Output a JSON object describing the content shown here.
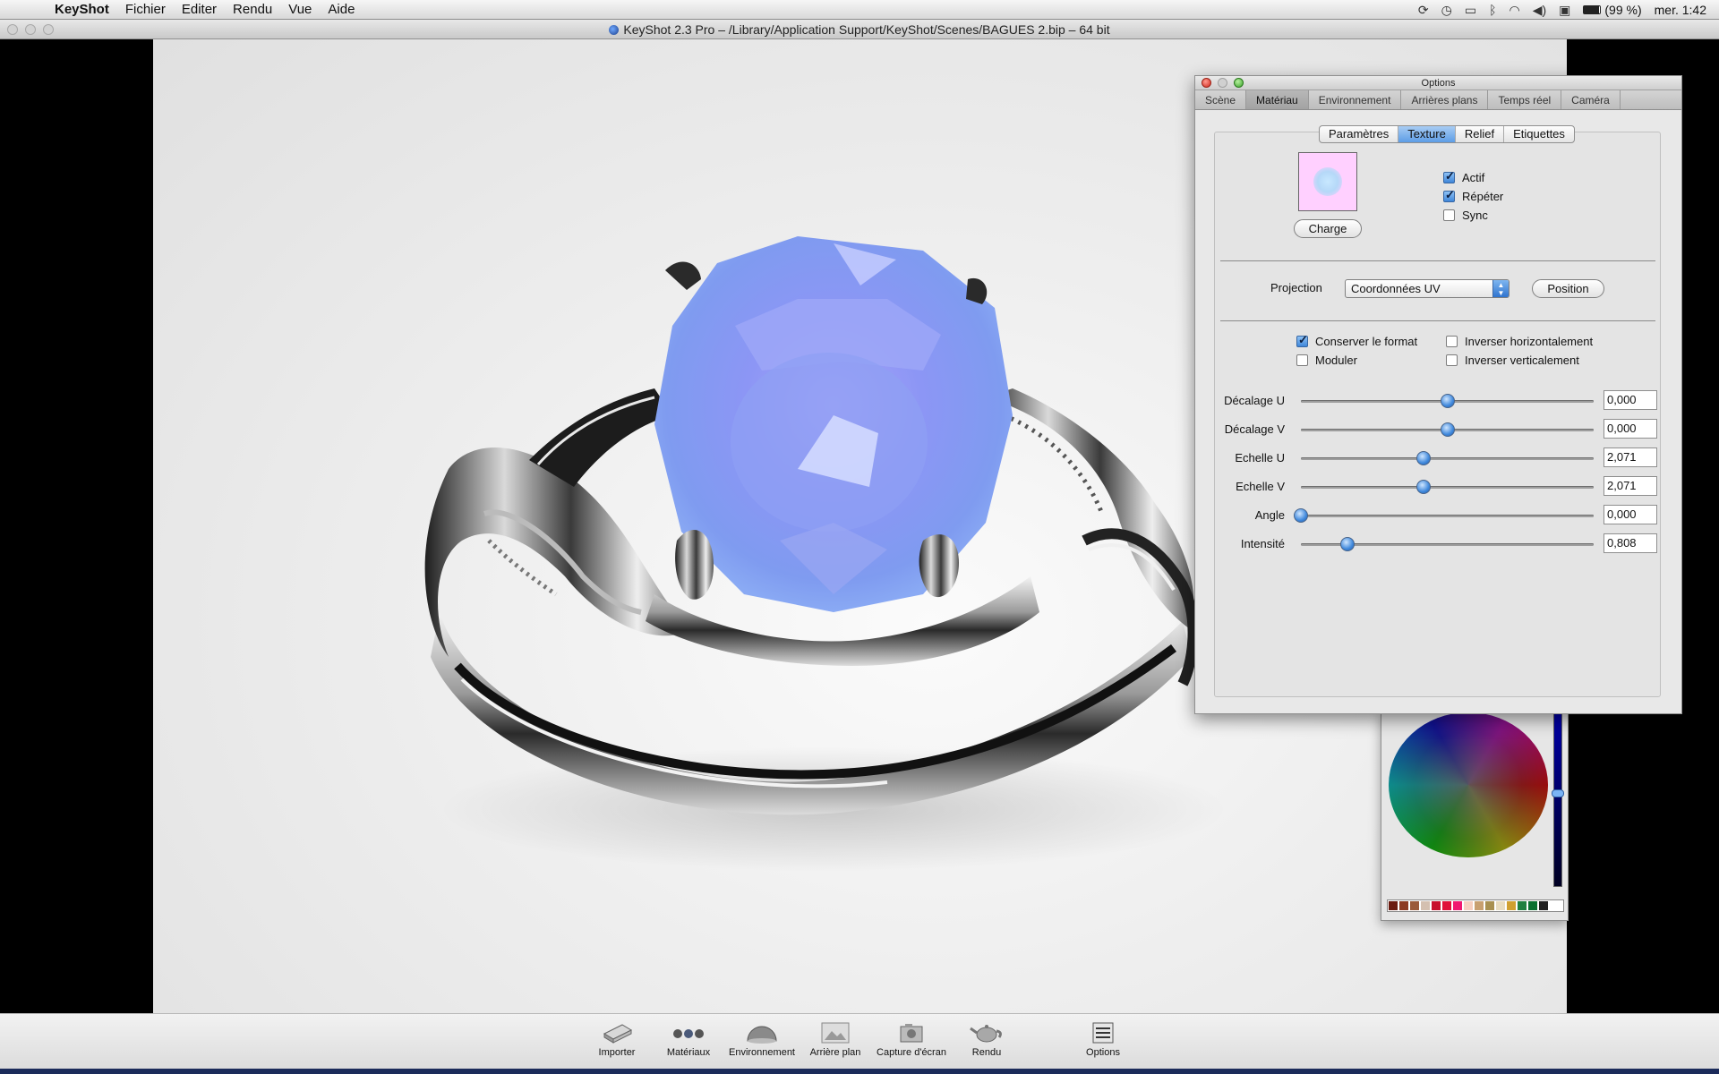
{
  "menubar": {
    "app_name": "KeyShot",
    "items": [
      "Fichier",
      "Editer",
      "Rendu",
      "Vue",
      "Aide"
    ],
    "battery": "(99 %)",
    "clock": "mer. 1:42"
  },
  "window": {
    "title": "KeyShot 2.3 Pro  – /Library/Application Support/KeyShot/Scenes/BAGUES 2.bip  – 64 bit"
  },
  "options_panel": {
    "title": "Options",
    "tabs": [
      "Scène",
      "Matériau",
      "Environnement",
      "Arrières plans",
      "Temps réel",
      "Caméra"
    ],
    "active_tab": "Matériau",
    "subtabs": [
      "Paramètres",
      "Texture",
      "Relief",
      "Etiquettes"
    ],
    "active_subtab": "Texture",
    "load_button": "Charge",
    "checkboxes_top": [
      {
        "label": "Actif",
        "checked": true
      },
      {
        "label": "Répéter",
        "checked": true
      },
      {
        "label": "Sync",
        "checked": false
      }
    ],
    "projection_label": "Projection",
    "projection_value": "Coordonnées UV",
    "position_button": "Position",
    "options_left": [
      {
        "label": "Conserver le format",
        "checked": true
      },
      {
        "label": "Moduler",
        "checked": false
      }
    ],
    "options_right": [
      {
        "label": "Inverser horizontalement",
        "checked": false
      },
      {
        "label": "Inverser verticalement",
        "checked": false
      }
    ],
    "sliders": [
      {
        "label": "Décalage U",
        "value": "0,000",
        "level": 0.5
      },
      {
        "label": "Décalage V",
        "value": "0,000",
        "level": 0.5
      },
      {
        "label": "Echelle U",
        "value": "2,071",
        "level": 0.42
      },
      {
        "label": "Echelle V",
        "value": "2,071",
        "level": 0.42
      },
      {
        "label": "Angle",
        "value": "0,000",
        "level": 0.0
      },
      {
        "label": "Intensité",
        "value": "0,808",
        "level": 0.16
      }
    ]
  },
  "toolbar": {
    "buttons": [
      {
        "label": "Importer",
        "icon": "import-icon"
      },
      {
        "label": "Matériaux",
        "icon": "materials-icon"
      },
      {
        "label": "Environnement",
        "icon": "environment-icon"
      },
      {
        "label": "Arrière plan",
        "icon": "background-icon"
      },
      {
        "label": "Capture d'écran",
        "icon": "camera-icon"
      },
      {
        "label": "Rendu",
        "icon": "teapot-icon"
      },
      {
        "label": "Options",
        "icon": "options-icon"
      }
    ]
  },
  "colors": {
    "gem": "#8c96f5",
    "accent": "#3f86d9",
    "swatches": [
      "#6b1b10",
      "#8c3a22",
      "#9a5a3a",
      "#d4c0b0",
      "#c8102e",
      "#e0103a",
      "#f01870",
      "#f6d0c0",
      "#c8a070",
      "#a89050",
      "#e8dcc0",
      "#d0a030",
      "#208040",
      "#0a7030",
      "#202020"
    ]
  }
}
